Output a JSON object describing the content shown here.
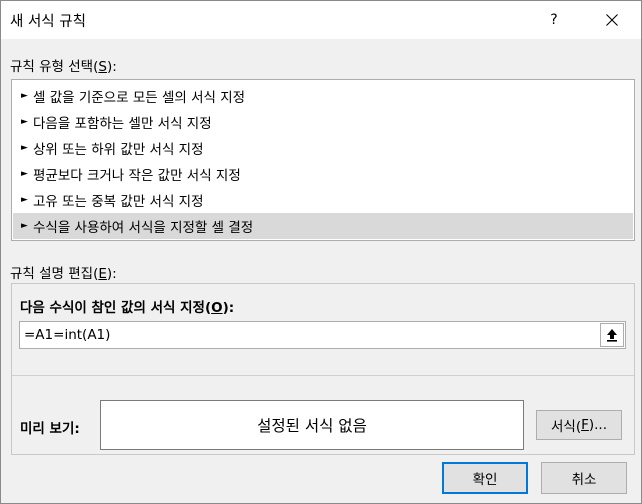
{
  "dialog": {
    "title": "새 서식 규칙",
    "help_label": "?"
  },
  "rule_type": {
    "label": "규칙 유형 선택(",
    "accel": "S",
    "label_end": "):",
    "arrow": "►",
    "items": [
      {
        "label": "셀 값을 기준으로 모든 셀의 서식 지정"
      },
      {
        "label": "다음을 포함하는 셀만 서식 지정"
      },
      {
        "label": "상위 또는 하위 값만 서식 지정"
      },
      {
        "label": "평균보다 크거나 작은 값만 서식 지정"
      },
      {
        "label": "고유 또는 중복 값만 서식 지정"
      },
      {
        "label": "수식을 사용하여 서식을 지정할 셀 결정"
      }
    ],
    "selected_index": 5
  },
  "rule_edit": {
    "label": "규칙 설명 편집(",
    "accel": "E",
    "label_end": "):",
    "formula_label": "다음 수식이 참인 값의 서식 지정(",
    "formula_accel": "O",
    "formula_label_end": "):",
    "formula_value": "=A1=int(A1)",
    "preview_label": "미리 보기:",
    "preview_text": "설정된 서식 없음",
    "format_button": "서식(",
    "format_accel": "F",
    "format_button_end": ")..."
  },
  "buttons": {
    "ok": "확인",
    "cancel": "취소"
  },
  "colors": {
    "selected_row": "#d9d9d9",
    "default_button_border": "#0078d7",
    "dialog_background": "#f0f0f0"
  }
}
